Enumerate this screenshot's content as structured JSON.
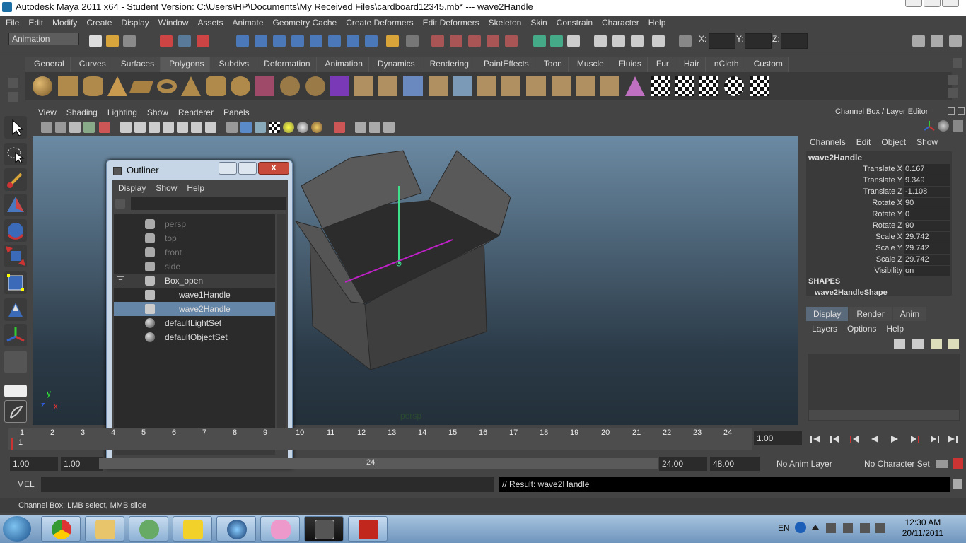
{
  "window": {
    "title": "Autodesk Maya 2011 x64 - Student Version: C:\\Users\\HP\\Documents\\My Received Files\\cardboard12345.mb*   ---   wave2Handle"
  },
  "menubar": [
    "File",
    "Edit",
    "Modify",
    "Create",
    "Display",
    "Window",
    "Assets",
    "Animate",
    "Geometry Cache",
    "Create Deformers",
    "Edit Deformers",
    "Skeleton",
    "Skin",
    "Constrain",
    "Character",
    "Help"
  ],
  "statusline": {
    "mode": "Animation",
    "x_label": "X:",
    "y_label": "Y:",
    "z_label": "Z:"
  },
  "shelf": {
    "tabs": [
      "General",
      "Curves",
      "Surfaces",
      "Polygons",
      "Subdivs",
      "Deformation",
      "Animation",
      "Dynamics",
      "Rendering",
      "PaintEffects",
      "Toon",
      "Muscle",
      "Fluids",
      "Fur",
      "Hair",
      "nCloth",
      "Custom"
    ],
    "active_tab": "Polygons"
  },
  "panel": {
    "menu": [
      "View",
      "Shading",
      "Lighting",
      "Show",
      "Renderer",
      "Panels"
    ],
    "camera_label": "persp",
    "axis_y": "y",
    "axis_z": "z",
    "axis_x": "x"
  },
  "outliner": {
    "title": "Outliner",
    "menu": [
      "Display",
      "Show",
      "Help"
    ],
    "close_glyph": "X",
    "items": [
      {
        "label": "persp",
        "dim": true
      },
      {
        "label": "top",
        "dim": true
      },
      {
        "label": "front",
        "dim": true
      },
      {
        "label": "side",
        "dim": true
      },
      {
        "label": "Box_open",
        "dim": false
      },
      {
        "label": "wave1Handle",
        "dim": false
      },
      {
        "label": "wave2Handle",
        "dim": false,
        "selected": true
      },
      {
        "label": "defaultLightSet",
        "dim": false
      },
      {
        "label": "defaultObjectSet",
        "dim": false
      }
    ],
    "expand_glyph": "−"
  },
  "channelbox": {
    "header": "Channel Box / Layer Editor",
    "menu": [
      "Channels",
      "Edit",
      "Object",
      "Show"
    ],
    "node": "wave2Handle",
    "channels": [
      {
        "name": "Translate X",
        "value": "0.167"
      },
      {
        "name": "Translate Y",
        "value": "9.349"
      },
      {
        "name": "Translate Z",
        "value": "-1.108"
      },
      {
        "name": "Rotate X",
        "value": "90"
      },
      {
        "name": "Rotate Y",
        "value": "0"
      },
      {
        "name": "Rotate Z",
        "value": "90"
      },
      {
        "name": "Scale X",
        "value": "29.742"
      },
      {
        "name": "Scale Y",
        "value": "29.742"
      },
      {
        "name": "Scale Z",
        "value": "29.742"
      },
      {
        "name": "Visibility",
        "value": "on"
      }
    ],
    "shapes_label": "SHAPES",
    "shape_node": "wave2HandleShape"
  },
  "layereditor": {
    "tabs": [
      "Display",
      "Render",
      "Anim"
    ],
    "active_tab": "Display",
    "menu": [
      "Layers",
      "Options",
      "Help"
    ]
  },
  "timeline": {
    "ticks": [
      "1",
      "2",
      "3",
      "4",
      "5",
      "6",
      "7",
      "8",
      "9",
      "10",
      "11",
      "12",
      "13",
      "14",
      "15",
      "16",
      "17",
      "18",
      "19",
      "20",
      "21",
      "22",
      "23",
      "24"
    ],
    "current_frame_marker": "1",
    "current_time": "1.00"
  },
  "range": {
    "start_time": "1.00",
    "playback_start": "1.00",
    "playback_end_marker": "24",
    "playback_end": "24.00",
    "end_time": "48.00",
    "anim_layer": "No Anim Layer",
    "character_set": "No Character Set"
  },
  "commandline": {
    "label": "MEL",
    "result": "// Result: wave2Handle"
  },
  "helpline": "Channel Box: LMB select, MMB slide",
  "taskbar": {
    "language": "EN",
    "time": "12:30 AM",
    "date": "20/11/2011"
  }
}
